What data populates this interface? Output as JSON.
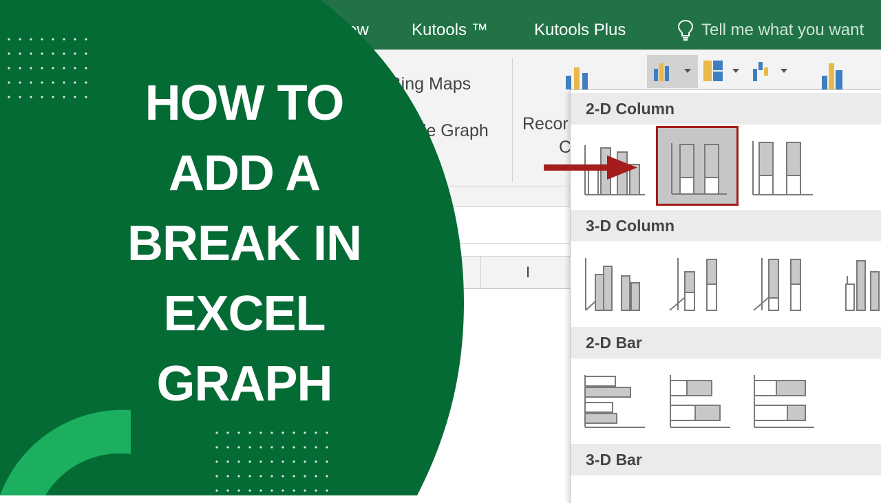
{
  "ribbon": {
    "tabs": [
      {
        "label": "ew"
      },
      {
        "label": "Kutools ™"
      },
      {
        "label": "Kutools Plus"
      }
    ],
    "tell_me": "Tell me what you want",
    "bing_maps": "Bing Maps",
    "people_graph": "ple Graph",
    "recommended_line1": "Recor",
    "recommended_line2": "C"
  },
  "sheet": {
    "column_label": "I"
  },
  "gallery": {
    "sections": [
      {
        "title": "2-D Column"
      },
      {
        "title": "3-D Column"
      },
      {
        "title": "2-D Bar"
      },
      {
        "title": "3-D Bar"
      }
    ],
    "selected_item": "stacked-column"
  },
  "overlay": {
    "title_lines": [
      "HOW TO",
      "ADD A",
      "BREAK IN",
      "EXCEL",
      "GRAPH"
    ],
    "colors": {
      "dark_green": "#056b35",
      "accent_green": "#1baf5f",
      "excel_green": "#217346",
      "highlight_red": "#a51c1c"
    }
  }
}
